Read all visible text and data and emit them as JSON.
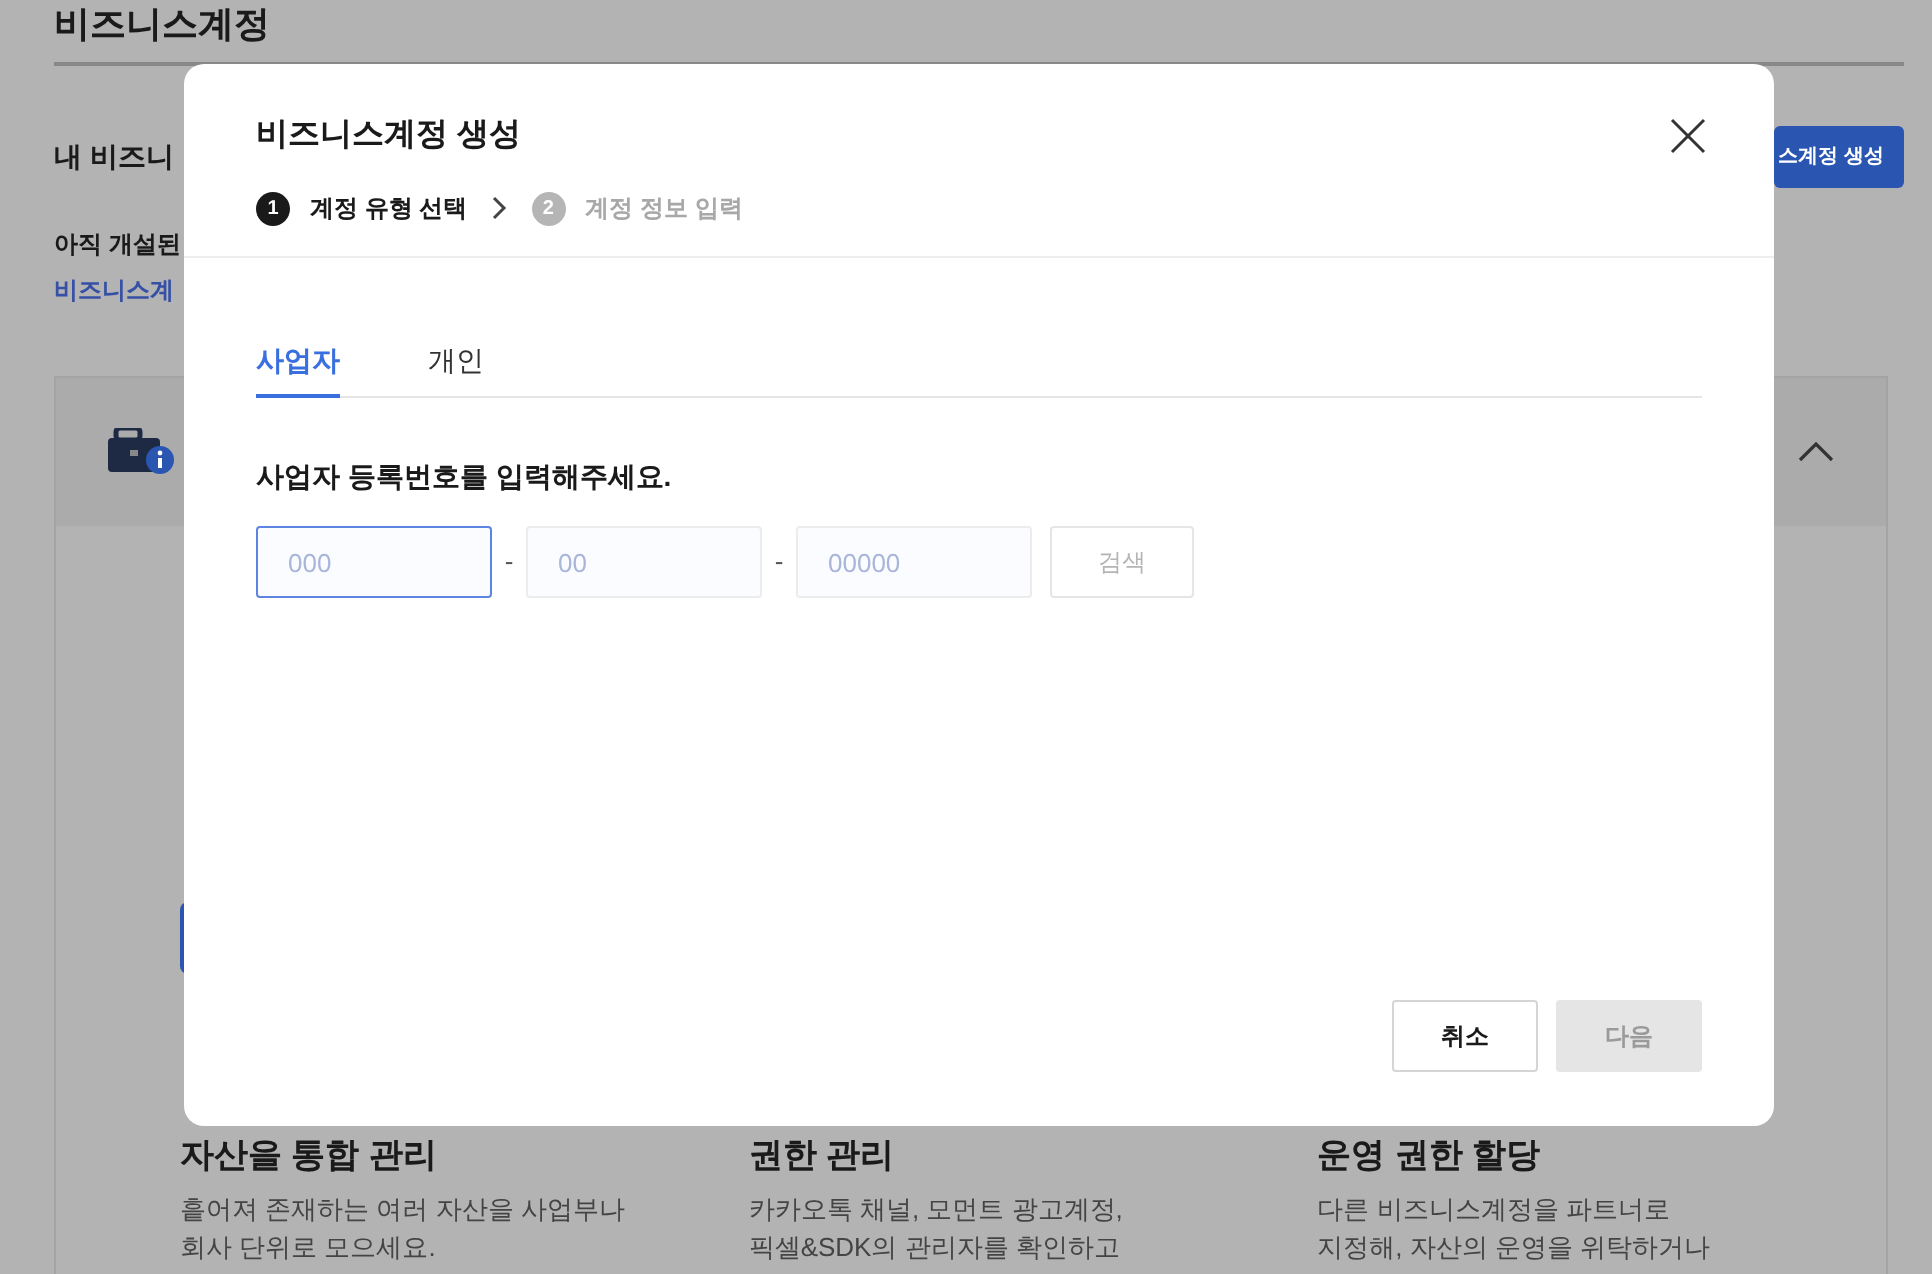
{
  "page": {
    "title": "비즈니스계정",
    "section_label": "내 비즈니",
    "create_button": "스계정 생성",
    "notice": "아직 개설된",
    "notice_link": "비즈니스계",
    "card": {
      "expanded": true,
      "features": [
        {
          "title": "자산을 통합 관리",
          "lines": [
            "흩어져 존재하는 여러 자산을 사업부나",
            "회사 단위로 모으세요."
          ]
        },
        {
          "title": "권한 관리",
          "lines": [
            "카카오톡 채널, 모먼트 광고계정,",
            "픽셀&SDK의 관리자를 확인하고"
          ]
        },
        {
          "title": "운영 권한 할당",
          "lines": [
            "다른 비즈니스계정을 파트너로",
            "지정해, 자산의 운영을 위탁하거나"
          ]
        }
      ]
    }
  },
  "dialog": {
    "title": "비즈니스계정 생성",
    "steps": [
      {
        "number": "1",
        "label": "계정 유형 선택",
        "active": true
      },
      {
        "number": "2",
        "label": "계정 정보 입력",
        "active": false
      }
    ],
    "tabs": [
      {
        "label": "사업자",
        "selected": true
      },
      {
        "label": "개인",
        "selected": false
      }
    ],
    "prompt": "사업자 등록번호를 입력해주세요.",
    "fields": [
      {
        "placeholder": "000",
        "focused": true
      },
      {
        "placeholder": "00",
        "focused": false
      },
      {
        "placeholder": "00000",
        "focused": false
      }
    ],
    "separators": [
      "-",
      "-"
    ],
    "search_button": "검색",
    "buttons": [
      {
        "label": "취소",
        "disabled": false
      },
      {
        "label": "다음",
        "disabled": true
      }
    ]
  }
}
